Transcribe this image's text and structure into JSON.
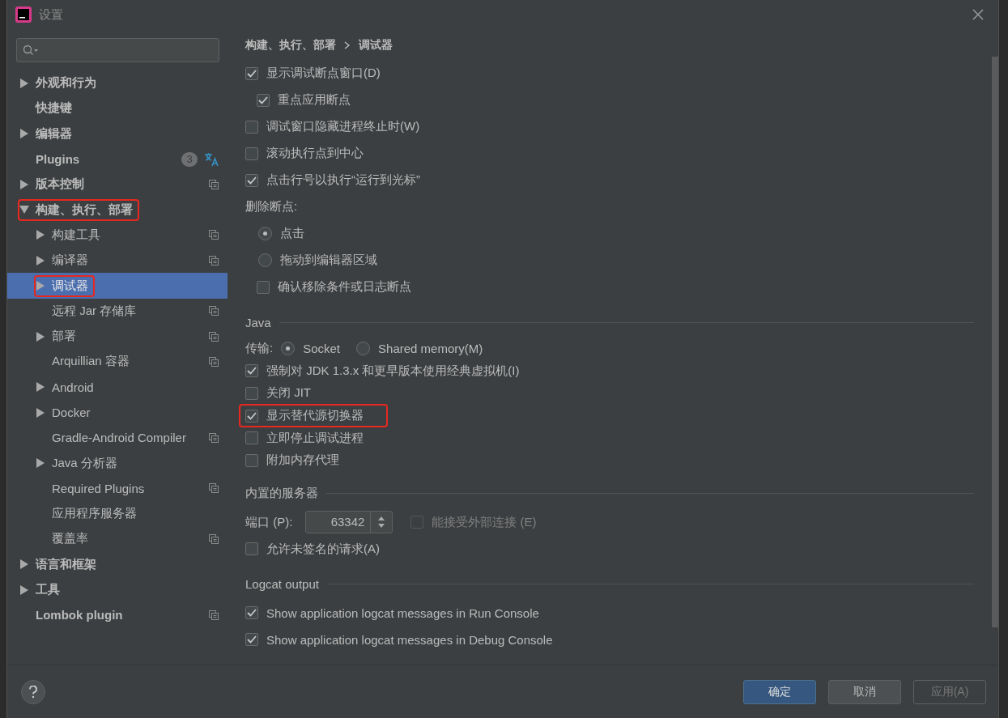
{
  "window": {
    "title": "设置"
  },
  "sidebar": {
    "items": [
      {
        "label": "外观和行为",
        "expanded": false,
        "selected": false,
        "highlighted": false
      },
      {
        "label": "快捷键",
        "selected": false,
        "highlighted": false
      },
      {
        "label": "编辑器",
        "expanded": false,
        "selected": false,
        "highlighted": false
      },
      {
        "label": "Plugins",
        "selected": false,
        "highlighted": false,
        "badge": "3",
        "translate_icon": true
      },
      {
        "label": "版本控制",
        "expanded": false,
        "selected": false,
        "highlighted": false,
        "project_icon": true
      },
      {
        "label": "构建、执行、部署",
        "expanded": true,
        "selected": false,
        "highlighted": true,
        "children": [
          {
            "label": "构建工具",
            "expanded": false,
            "selected": false,
            "highlighted": false,
            "project_icon": true
          },
          {
            "label": "编译器",
            "expanded": false,
            "selected": false,
            "highlighted": false,
            "project_icon": true
          },
          {
            "label": "调试器",
            "expanded": false,
            "selected": true,
            "highlighted": true
          },
          {
            "label": "远程 Jar 存储库",
            "selected": false,
            "highlighted": false,
            "project_icon": true
          },
          {
            "label": "部署",
            "expanded": false,
            "selected": false,
            "highlighted": false,
            "project_icon": true
          },
          {
            "label": "Arquillian 容器",
            "selected": false,
            "highlighted": false,
            "project_icon": true
          },
          {
            "label": "Android",
            "expanded": false,
            "selected": false,
            "highlighted": false
          },
          {
            "label": "Docker",
            "expanded": false,
            "selected": false,
            "highlighted": false
          },
          {
            "label": "Gradle-Android Compiler",
            "selected": false,
            "highlighted": false,
            "project_icon": true
          },
          {
            "label": "Java 分析器",
            "expanded": false,
            "selected": false,
            "highlighted": false
          },
          {
            "label": "Required Plugins",
            "selected": false,
            "highlighted": false,
            "project_icon": true
          },
          {
            "label": "应用程序服务器",
            "selected": false,
            "highlighted": false
          },
          {
            "label": "覆盖率",
            "selected": false,
            "highlighted": false,
            "project_icon": true
          }
        ]
      },
      {
        "label": "语言和框架",
        "expanded": false,
        "selected": false,
        "highlighted": false
      },
      {
        "label": "工具",
        "expanded": false,
        "selected": false,
        "highlighted": false
      },
      {
        "label": "Lombok plugin",
        "selected": false,
        "highlighted": false,
        "project_icon": true
      }
    ]
  },
  "content": {
    "breadcrumb": [
      "构建、执行、部署",
      "调试器"
    ],
    "sections": [
      {
        "rows": [
          {
            "kind": "checkbox",
            "label": "显示调试断点窗口(D)",
            "checked": true,
            "highlighted": false,
            "children": [
              {
                "kind": "checkbox",
                "label": "重点应用断点",
                "checked": true,
                "highlighted": false
              }
            ]
          },
          {
            "kind": "checkbox",
            "label": "调试窗口隐藏进程终止时(W)",
            "checked": false,
            "highlighted": false
          },
          {
            "kind": "checkbox",
            "label": "滚动执行点到中心",
            "checked": false,
            "highlighted": false
          },
          {
            "kind": "checkbox",
            "label": "点击行号以执行“运行到光标”",
            "checked": true,
            "highlighted": false
          },
          {
            "kind": "label",
            "label": "删除断点:",
            "children": [
              {
                "kind": "radio",
                "label": "点击",
                "selected": true
              },
              {
                "kind": "radio",
                "label": "拖动到编辑器区域",
                "selected": false
              },
              {
                "kind": "checkbox",
                "label": "确认移除条件或日志断点",
                "checked": false,
                "highlighted": false
              }
            ]
          }
        ]
      },
      {
        "title": "Java",
        "rows": [
          {
            "kind": "radio_group",
            "label": "传输:",
            "options": [
              {
                "label": "Socket",
                "selected": true
              },
              {
                "label": "Shared memory(M)",
                "selected": false
              }
            ]
          },
          {
            "kind": "checkbox",
            "label": "强制对 JDK 1.3.x 和更早版本使用经典虚拟机(I)",
            "checked": true,
            "highlighted": false
          },
          {
            "kind": "checkbox",
            "label": "关闭 JIT",
            "checked": false,
            "highlighted": false
          },
          {
            "kind": "checkbox",
            "label": "显示替代源切换器",
            "checked": true,
            "highlighted": true
          },
          {
            "kind": "checkbox",
            "label": "立即停止调试进程",
            "checked": false,
            "highlighted": false
          },
          {
            "kind": "checkbox",
            "label": "附加内存代理",
            "checked": false,
            "highlighted": false
          }
        ]
      },
      {
        "title": "内置的服务器",
        "rows": [
          {
            "kind": "port",
            "label": "端口 (P):",
            "value": "63342",
            "option": {
              "label": "能接受外部连接 (E)",
              "checked": false,
              "disabled": true
            }
          },
          {
            "kind": "checkbox",
            "label": "允许未签名的请求(A)",
            "checked": false,
            "highlighted": false
          }
        ]
      },
      {
        "title": "Logcat output",
        "rows": [
          {
            "kind": "checkbox",
            "label": "Show application logcat messages in Run Console",
            "checked": true,
            "highlighted": false
          },
          {
            "kind": "checkbox",
            "label": "Show application logcat messages in Debug Console",
            "checked": true,
            "highlighted": false
          }
        ]
      }
    ]
  },
  "buttons": [
    {
      "label": "确定",
      "kind": "primary",
      "disabled": false
    },
    {
      "label": "取消",
      "kind": "normal",
      "disabled": false
    },
    {
      "label": "应用(A)",
      "kind": "normal",
      "disabled": true
    }
  ]
}
